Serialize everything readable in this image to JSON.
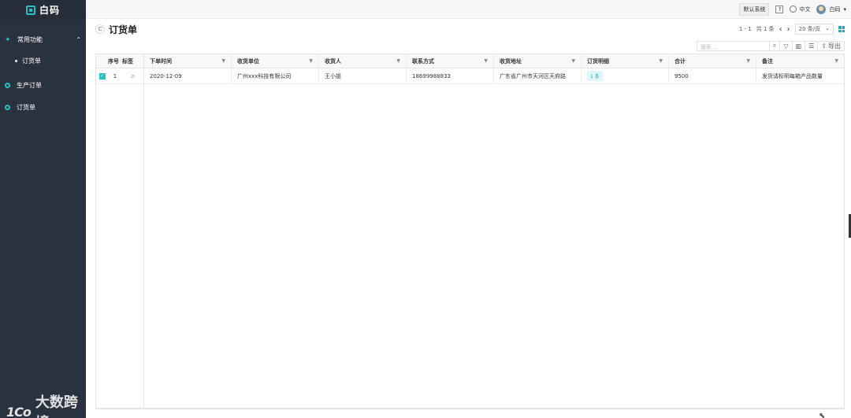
{
  "app": {
    "logo_text": "白码"
  },
  "sidebar": {
    "group_label": "常用功能",
    "sub_items": [
      {
        "label": "订货单"
      }
    ],
    "items": [
      {
        "label": "生产订单"
      },
      {
        "label": "订货单"
      }
    ]
  },
  "topbar": {
    "system_button": "默认系统",
    "language": "中文",
    "user_name": "白码"
  },
  "page": {
    "title": "订货单"
  },
  "pager": {
    "range": "1 - 1",
    "total_text": "共 1 条",
    "page_size": "20 条/页"
  },
  "toolbar": {
    "search_placeholder": "搜索...",
    "export_label": "导出"
  },
  "table": {
    "columns": {
      "no": "序号",
      "tag": "标签",
      "order_time": "下单时间",
      "receiver_unit": "收货单位",
      "receiver": "收货人",
      "contact": "联系方式",
      "address": "收货地址",
      "detail": "订货明细",
      "total": "合计",
      "remark": "备注"
    },
    "rows": [
      {
        "no": "1",
        "order_time": "2020-12-09",
        "receiver_unit": "广州xxx科技有限公司",
        "receiver": "王小姐",
        "contact": "18699988833",
        "address": "广东省广州市天河区天府路",
        "detail": "1 条",
        "total": "9500",
        "remark": "发货请标明每箱产品数量"
      }
    ]
  },
  "watermark": {
    "logo": "1Co",
    "text": "大数跨境"
  },
  "colors": {
    "sidebar_bg": "#2b323f",
    "accent": "#22c0c9"
  },
  "icons": [
    "logo-icon",
    "star-icon",
    "chevron-up-icon",
    "ring-icon",
    "help-icon",
    "globe-icon",
    "avatar",
    "refresh-icon",
    "prev-icon",
    "next-icon",
    "grid-icon",
    "search-icon",
    "filter-icon",
    "chart-icon",
    "settings-icon",
    "export-icon",
    "clip-icon"
  ]
}
